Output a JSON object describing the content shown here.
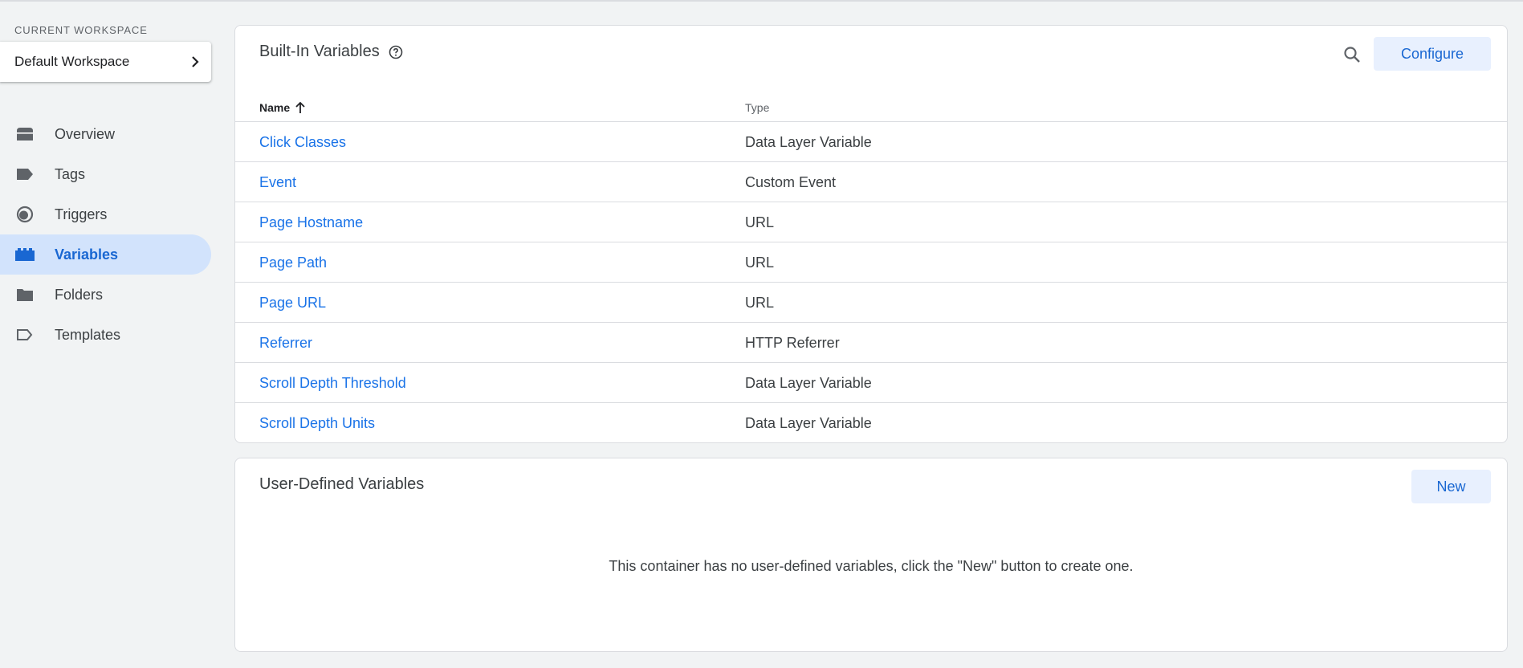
{
  "sidebar": {
    "workspace_label": "CURRENT WORKSPACE",
    "workspace_name": "Default Workspace",
    "items": [
      {
        "label": "Overview",
        "icon": "overview-icon",
        "active": false
      },
      {
        "label": "Tags",
        "icon": "tag-icon",
        "active": false
      },
      {
        "label": "Triggers",
        "icon": "triggers-icon",
        "active": false
      },
      {
        "label": "Variables",
        "icon": "variables-icon",
        "active": true
      },
      {
        "label": "Folders",
        "icon": "folder-icon",
        "active": false
      },
      {
        "label": "Templates",
        "icon": "template-icon",
        "active": false
      }
    ]
  },
  "builtin": {
    "title": "Built-In Variables",
    "configure_label": "Configure",
    "columns": {
      "name": "Name",
      "type": "Type"
    },
    "rows": [
      {
        "name": "Click Classes",
        "type": "Data Layer Variable"
      },
      {
        "name": "Event",
        "type": "Custom Event"
      },
      {
        "name": "Page Hostname",
        "type": "URL"
      },
      {
        "name": "Page Path",
        "type": "URL"
      },
      {
        "name": "Page URL",
        "type": "URL"
      },
      {
        "name": "Referrer",
        "type": "HTTP Referrer"
      },
      {
        "name": "Scroll Depth Threshold",
        "type": "Data Layer Variable"
      },
      {
        "name": "Scroll Depth Units",
        "type": "Data Layer Variable"
      }
    ]
  },
  "userdefined": {
    "title": "User-Defined Variables",
    "new_label": "New",
    "empty_message": "This container has no user-defined variables, click the \"New\" button to create one."
  },
  "colors": {
    "accent": "#1a73e8",
    "active_bg": "#d2e3fc",
    "button_bg": "#e8f0fe"
  }
}
